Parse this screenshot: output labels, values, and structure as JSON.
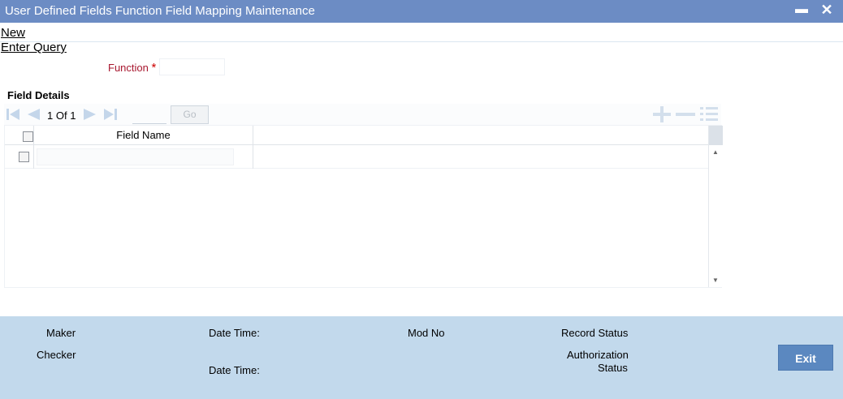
{
  "window": {
    "title": "User Defined Fields Function Field Mapping Maintenance",
    "minimize": "▬",
    "close": "✕"
  },
  "menu": {
    "new": "New",
    "enter_query": "Enter Query"
  },
  "form": {
    "function_label": "Function",
    "required_mark": "*",
    "function_value": ""
  },
  "field_details": {
    "title": "Field Details",
    "pagination": {
      "current": "1",
      "of_label": "Of",
      "total": "1",
      "page_value": "",
      "go_label": "Go"
    },
    "columns": [
      "Field Name"
    ],
    "rows": [
      {
        "field_name": ""
      }
    ]
  },
  "footer": {
    "maker": "Maker",
    "checker": "Checker",
    "date_time_1": "Date Time:",
    "date_time_2": "Date Time:",
    "mod_no": "Mod No",
    "record_status": "Record Status",
    "authorization": "Authorization",
    "status": "Status",
    "exit": "Exit"
  },
  "colors": {
    "titlebar": "#6c8cc4",
    "footer": "#c2d9ec",
    "exit_button": "#5b88c0",
    "label_red": "#a8172f"
  }
}
